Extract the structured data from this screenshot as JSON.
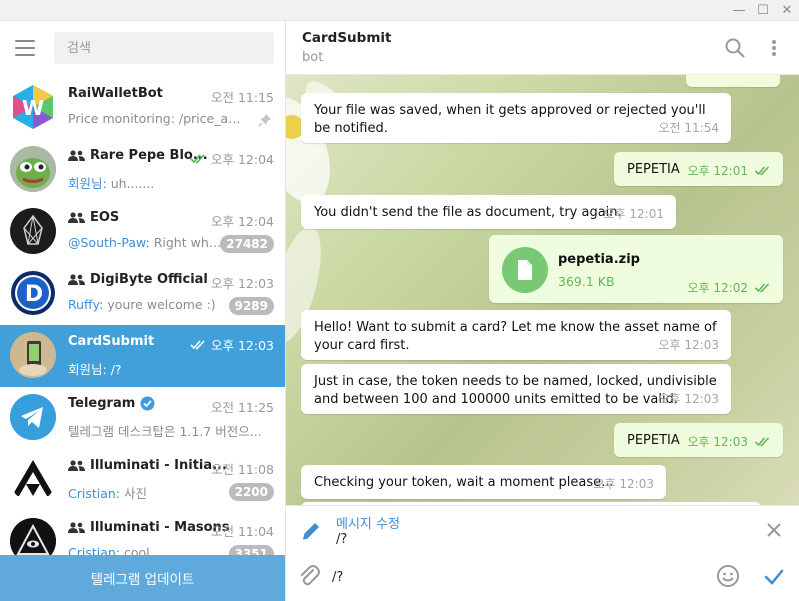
{
  "window": {
    "minimize": "—",
    "maximize": "☐",
    "close": "✕"
  },
  "search": {
    "placeholder": "검색"
  },
  "chats": [
    {
      "name": "RaiWalletBot",
      "time": "오전 11:15",
      "preview": "Price monitoring: /price_abo...",
      "who": "",
      "pinned": true,
      "badge": "",
      "group": false,
      "checks": false
    },
    {
      "name": "Rare Pepe Blo...",
      "time": "오후 12:04",
      "preview": "uh.......",
      "who": "회원님: ",
      "pinned": false,
      "badge": "",
      "group": true,
      "checks": true
    },
    {
      "name": "EOS",
      "time": "오후 12:04",
      "preview": "Right why ...",
      "who": "@South-Paw: ",
      "pinned": false,
      "badge": "27482",
      "group": true,
      "checks": false
    },
    {
      "name": "DigiByte Official",
      "time": "오후 12:03",
      "preview": "youre welcome :)",
      "who": "Ruffy: ",
      "pinned": false,
      "badge": "9289",
      "group": true,
      "checks": false
    },
    {
      "name": "CardSubmit",
      "time": "오후 12:03",
      "preview": "/?",
      "who": "회원님: ",
      "pinned": false,
      "badge": "",
      "group": false,
      "checks": true,
      "active": true
    },
    {
      "name": "Telegram",
      "time": "오전 11:25",
      "preview": "텔레그램 데스크탑은 1.1.7 버전으...",
      "who": "",
      "pinned": false,
      "badge": "",
      "group": false,
      "checks": false,
      "verified": true
    },
    {
      "name": "Illuminati - Initia...",
      "time": "오전 11:08",
      "preview": "사진",
      "who": "Cristian: ",
      "pinned": false,
      "badge": "2200",
      "group": true,
      "checks": false
    },
    {
      "name": "Illuminati - Masons",
      "time": "오전 11:04",
      "preview": "cool",
      "who": "Cristian: ",
      "pinned": false,
      "badge": "3351",
      "group": true,
      "checks": false
    }
  ],
  "update_label": "텔레그램 업데이트",
  "peer": {
    "name": "CardSubmit",
    "status": "bot"
  },
  "messages": [
    {
      "dir": "in",
      "text": "Your file was saved, when it gets approved or rejected you'll be notified.",
      "time": "오전 11:54"
    },
    {
      "dir": "out",
      "text": "PEPETIA",
      "time": "오후 12:01"
    },
    {
      "dir": "in",
      "text": "You didn't send the file as document, try again.",
      "time": "오후 12:01"
    },
    {
      "dir": "out",
      "file": "pepetia.zip",
      "size": "369.1 KB",
      "time": "오후 12:02"
    },
    {
      "dir": "in",
      "text": "Hello! Want to submit a card? Let me know the asset name of your card first.",
      "time": "오후 12:03"
    },
    {
      "dir": "in",
      "text": "Just in case, the token needs to be named, locked, undivisible and between 100 and 100000 units emitted to be valid.",
      "time": "오후 12:03"
    },
    {
      "dir": "out",
      "text": "PEPETIA",
      "time": "오후 12:03"
    },
    {
      "dir": "in",
      "text": "Checking your token, wait a moment please...",
      "time": "오후 12:03"
    }
  ],
  "compose": {
    "edit_title": "메시지 수정",
    "edit_original": "/?",
    "input_value": "/?"
  },
  "colors": {
    "accent": "#419fd9",
    "update_bar": "#5fa9dd",
    "out_bubble": "#effdde",
    "badge": "#bbbbbb"
  }
}
